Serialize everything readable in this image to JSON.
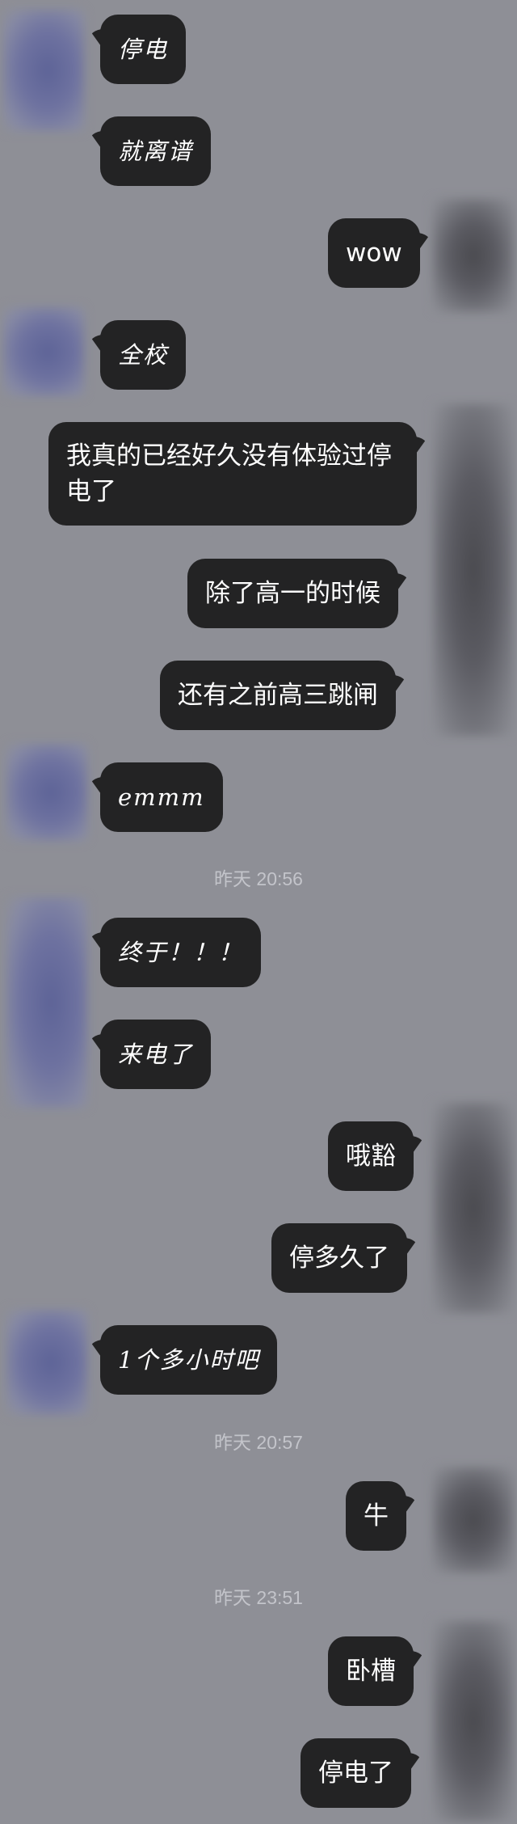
{
  "chat": {
    "messages": [
      {
        "side": "left",
        "text": "停电"
      },
      {
        "side": "left",
        "text": "就离谱"
      },
      {
        "side": "right",
        "text": "wow"
      },
      {
        "side": "left",
        "text": "全校"
      },
      {
        "side": "right",
        "text": "我真的已经好久没有体验过停电了"
      },
      {
        "side": "right",
        "text": "除了高一的时候"
      },
      {
        "side": "right",
        "text": "还有之前高三跳闸"
      },
      {
        "side": "left",
        "text": "emmm"
      },
      {
        "timestamp": "昨天 20:56"
      },
      {
        "side": "left",
        "text": "终于！！！"
      },
      {
        "side": "left",
        "text": "来电了"
      },
      {
        "side": "right",
        "text": "哦豁"
      },
      {
        "side": "right",
        "text": "停多久了"
      },
      {
        "side": "left",
        "text": "1个多小时吧"
      },
      {
        "timestamp": "昨天 20:57"
      },
      {
        "side": "right",
        "text": "牛"
      },
      {
        "timestamp": "昨天 23:51"
      },
      {
        "side": "right",
        "text": "卧槽"
      },
      {
        "side": "right",
        "text": "停电了"
      }
    ]
  },
  "colors": {
    "background": "#8e8f96",
    "bubble": "#232324",
    "bubble_text": "#ffffff",
    "timestamp_text": "#c3c4ca"
  }
}
